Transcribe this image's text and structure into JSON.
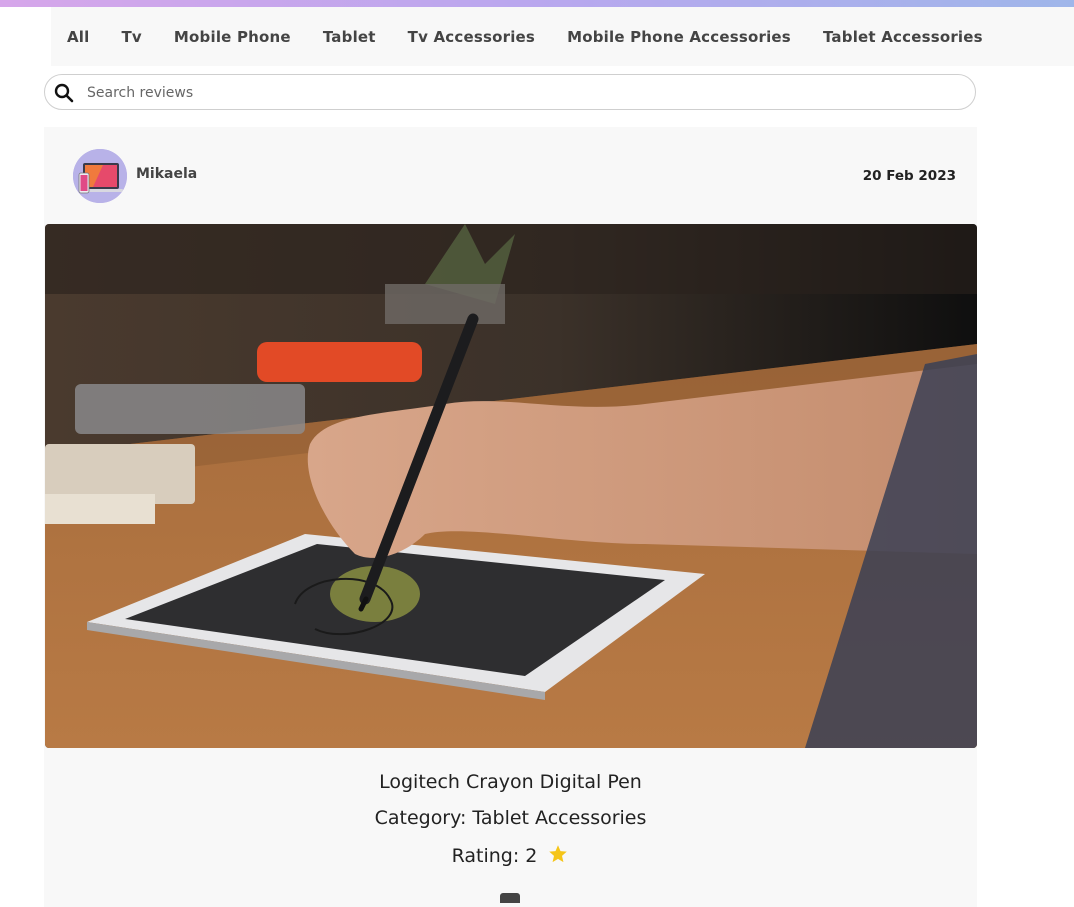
{
  "nav": {
    "items": [
      {
        "label": "All"
      },
      {
        "label": "Tv"
      },
      {
        "label": "Mobile Phone"
      },
      {
        "label": "Tablet"
      },
      {
        "label": "Tv Accessories"
      },
      {
        "label": "Mobile Phone Accessories"
      },
      {
        "label": "Tablet Accessories"
      }
    ]
  },
  "search": {
    "placeholder": "Search reviews",
    "icon": "search-icon"
  },
  "review": {
    "author": "Mikaela",
    "date": "20 Feb 2023",
    "image_alt": "Hand drawing on tablet with digital pen",
    "title": "Logitech Crayon Digital Pen",
    "category_text": "Category: Tablet Accessories",
    "rating_text": "Rating: 2",
    "star_icon": "star-icon",
    "star_color": "#f5c518"
  },
  "colors": {
    "accent_gradient_start": "#d6a6ea",
    "accent_gradient_end": "#9fb6ea"
  }
}
